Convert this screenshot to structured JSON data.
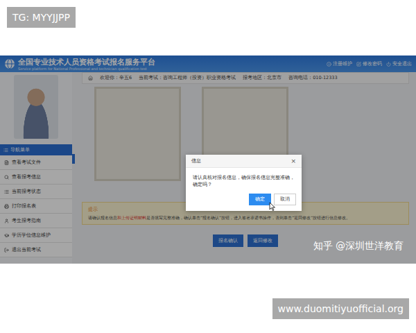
{
  "labels": {
    "top": "TG: MYYJJPP",
    "bottom": "www.duomitiyuofficial.org"
  },
  "header": {
    "title": "全国专业技术人员资格考试报名服务平台",
    "subtitle": "Service platform for National Professional and technician qualification test",
    "links": [
      "注册维护",
      "修改密码",
      "安全退出"
    ]
  },
  "info_bar": {
    "items": [
      "欢迎你：辛五6",
      "当前考试：咨询工程师（投资）职业资格考试",
      "报考地区：北京市",
      "咨询电话：010-12333"
    ]
  },
  "sidebar": {
    "menu_title": "导航菜单",
    "items": [
      {
        "label": "查看考试文件",
        "selected": false
      },
      {
        "label": "查看报考信息",
        "selected": false
      },
      {
        "label": "当前报考状态",
        "selected": false
      },
      {
        "label": "打印报名表",
        "selected": false
      },
      {
        "label": "考生报考指南",
        "selected": false
      },
      {
        "label": "学历学位信息维护",
        "selected": false
      },
      {
        "label": "退出当前考试",
        "selected": false
      }
    ]
  },
  "tip": {
    "title": "提示",
    "segments": [
      {
        "text": "请确认报名信息",
        "highlight": false
      },
      {
        "text": "和上传证明材料",
        "highlight": true
      },
      {
        "text": "是否填写完整准确，确认单击“报名确认”按钮，进入签署承诺书操作，否则单击“返回修改”按钮进行信息修改。",
        "highlight": false
      }
    ]
  },
  "actions": [
    "报名确认",
    "返回修改"
  ],
  "dialog": {
    "title": "信息",
    "close": "×",
    "message": "请认真核对报名信息，确保报名信息完整准确，确定吗？",
    "buttons": [
      {
        "label": "确定",
        "primary": true
      },
      {
        "label": "取消",
        "primary": false
      }
    ]
  },
  "watermark": "知乎 @深圳世洋教育"
}
